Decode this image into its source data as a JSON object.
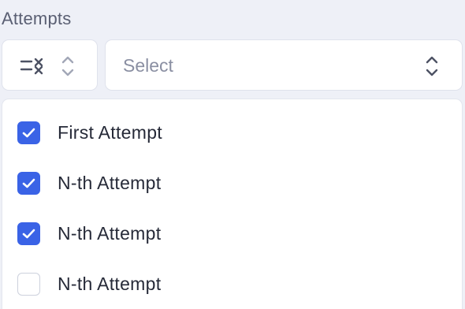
{
  "filter": {
    "label": "Attempts",
    "mode_icon": "list-x-icon",
    "mode_toggle_icon": "chevron-up-down-icon",
    "select": {
      "placeholder": "Select",
      "icon": "chevron-up-down-icon"
    }
  },
  "dropdown": {
    "options": [
      {
        "label": "First Attempt",
        "checked": true
      },
      {
        "label": "N-th Attempt",
        "checked": true
      },
      {
        "label": "N-th Attempt",
        "checked": true
      },
      {
        "label": "N-th Attempt",
        "checked": false
      }
    ]
  },
  "colors": {
    "accent": "#3a63e6",
    "background": "#eef0f7",
    "text": "#262a38",
    "muted_text": "#8a8fa2",
    "border": "#dfe2ec"
  }
}
